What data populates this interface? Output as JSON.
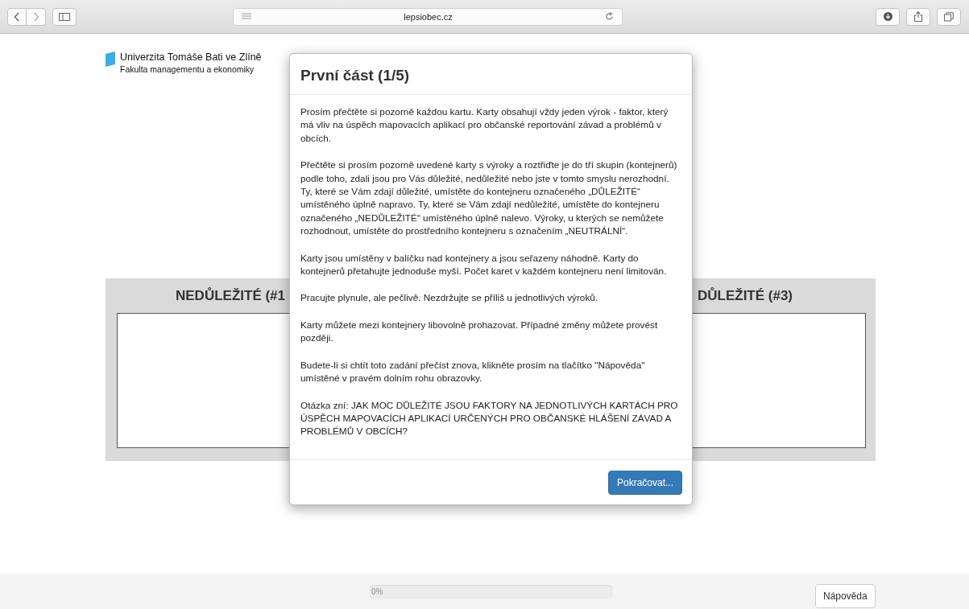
{
  "browser": {
    "url": "lepsiobec.cz"
  },
  "logo": {
    "line_1": "Univerzita Tomáše Bati ve Zlíně",
    "line_2": "Fakulta managementu a ekonomiky"
  },
  "containers": [
    {
      "kind": "left",
      "heading": "NEDŮLEŽITÉ (#1"
    },
    {
      "kind": "right",
      "heading": "DŮLEŽITÉ (#3)"
    }
  ],
  "modal": {
    "title": "První část (1/5)",
    "paragraphs": [
      "Prosím přečtěte si pozorně každou kartu. Karty obsahují vždy jeden výrok - faktor, který má vliv na úspěch mapovacích aplikací pro občanské reportování závad a problémů v obcích.",
      "Přečtěte si prosím pozorně uvedené karty s výroky a roztřiďte je do tří skupin (kontejnerů) podle toho, zdali jsou pro Vás důležité, nedůležité nebo jste v tomto smyslu nerozhodní. Ty, které se Vám zdají důležité, umístěte do kontejneru označeného „DŮLEŽITÉ“ umístěného úplně napravo. Ty, které se Vám zdají nedůležité, umístěte do kontejneru označeného „NEDŮLEŽITÉ“ umístěného úplně nalevo. Výroky, u kterých se nemůžete rozhodnout, umístěte do prostředního kontejneru s označením „NEUTRÁLNÍ“.",
      "Karty jsou umístěny v balíčku nad kontejnery a jsou seřazeny náhodně. Karty do kontejnerů přetahujte jednoduše myší. Počet karet v každém kontejneru není limitován.",
      "Pracujte plynule, ale pečlivě. Nezdržujte se příliš u jednotlivých výroků.",
      "Karty můžete mezi kontejnery libovolně prohazovat. Případné změny můžete provést později.",
      "Budete-li si chtít toto zadání přečíst znova, klikněte prosím na tlačítko \"Nápověda\" umístěné v pravém dolním rohu obrazovky.",
      "Otázka zní: JAK MOC DŮLEŽITÉ JSOU FAKTORY NA JEDNOTLIVÝCH KARTÁCH PRO ÚSPĚCH MAPOVACÍCH APLIKACÍ URČENÝCH PRO OBČANSKÉ HLÁŠENÍ ZÁVAD A PROBLÉMŮ V OBCÍCH?"
    ],
    "button": "Pokračovat..."
  },
  "footer": {
    "progress": {
      "level": 0,
      "label": "0%"
    },
    "help_button": "Nápověda"
  }
}
